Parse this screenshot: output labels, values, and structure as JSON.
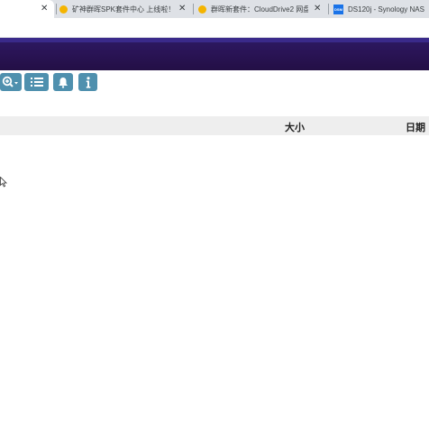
{
  "browser": {
    "tabs": [
      {
        "label": "",
        "close": "✕",
        "active": true
      },
      {
        "label": "矿神群晖SPK套件中心 上线啦！",
        "close": "✕",
        "icon_color": "#f4b400"
      },
      {
        "label": "群晖新套件：CloudDrive2 网盘",
        "close": "✕",
        "icon_color": "#f4b400"
      },
      {
        "label": "DS120j - Synology NAS",
        "close": "",
        "icon_color": "#1a73e8",
        "icon_text": "DSM"
      }
    ]
  },
  "header": {
    "accent": "#2a1456"
  },
  "toolbar": {
    "buttons": [
      {
        "name": "zoom-dropdown-button",
        "icon": "zoom-in-icon"
      },
      {
        "name": "list-view-button",
        "icon": "list-icon"
      },
      {
        "name": "notifications-button",
        "icon": "bell-icon"
      },
      {
        "name": "info-button",
        "icon": "info-icon"
      }
    ],
    "color": "#4f90ae"
  },
  "table": {
    "columns": {
      "size": "大小",
      "date": "日期"
    }
  }
}
